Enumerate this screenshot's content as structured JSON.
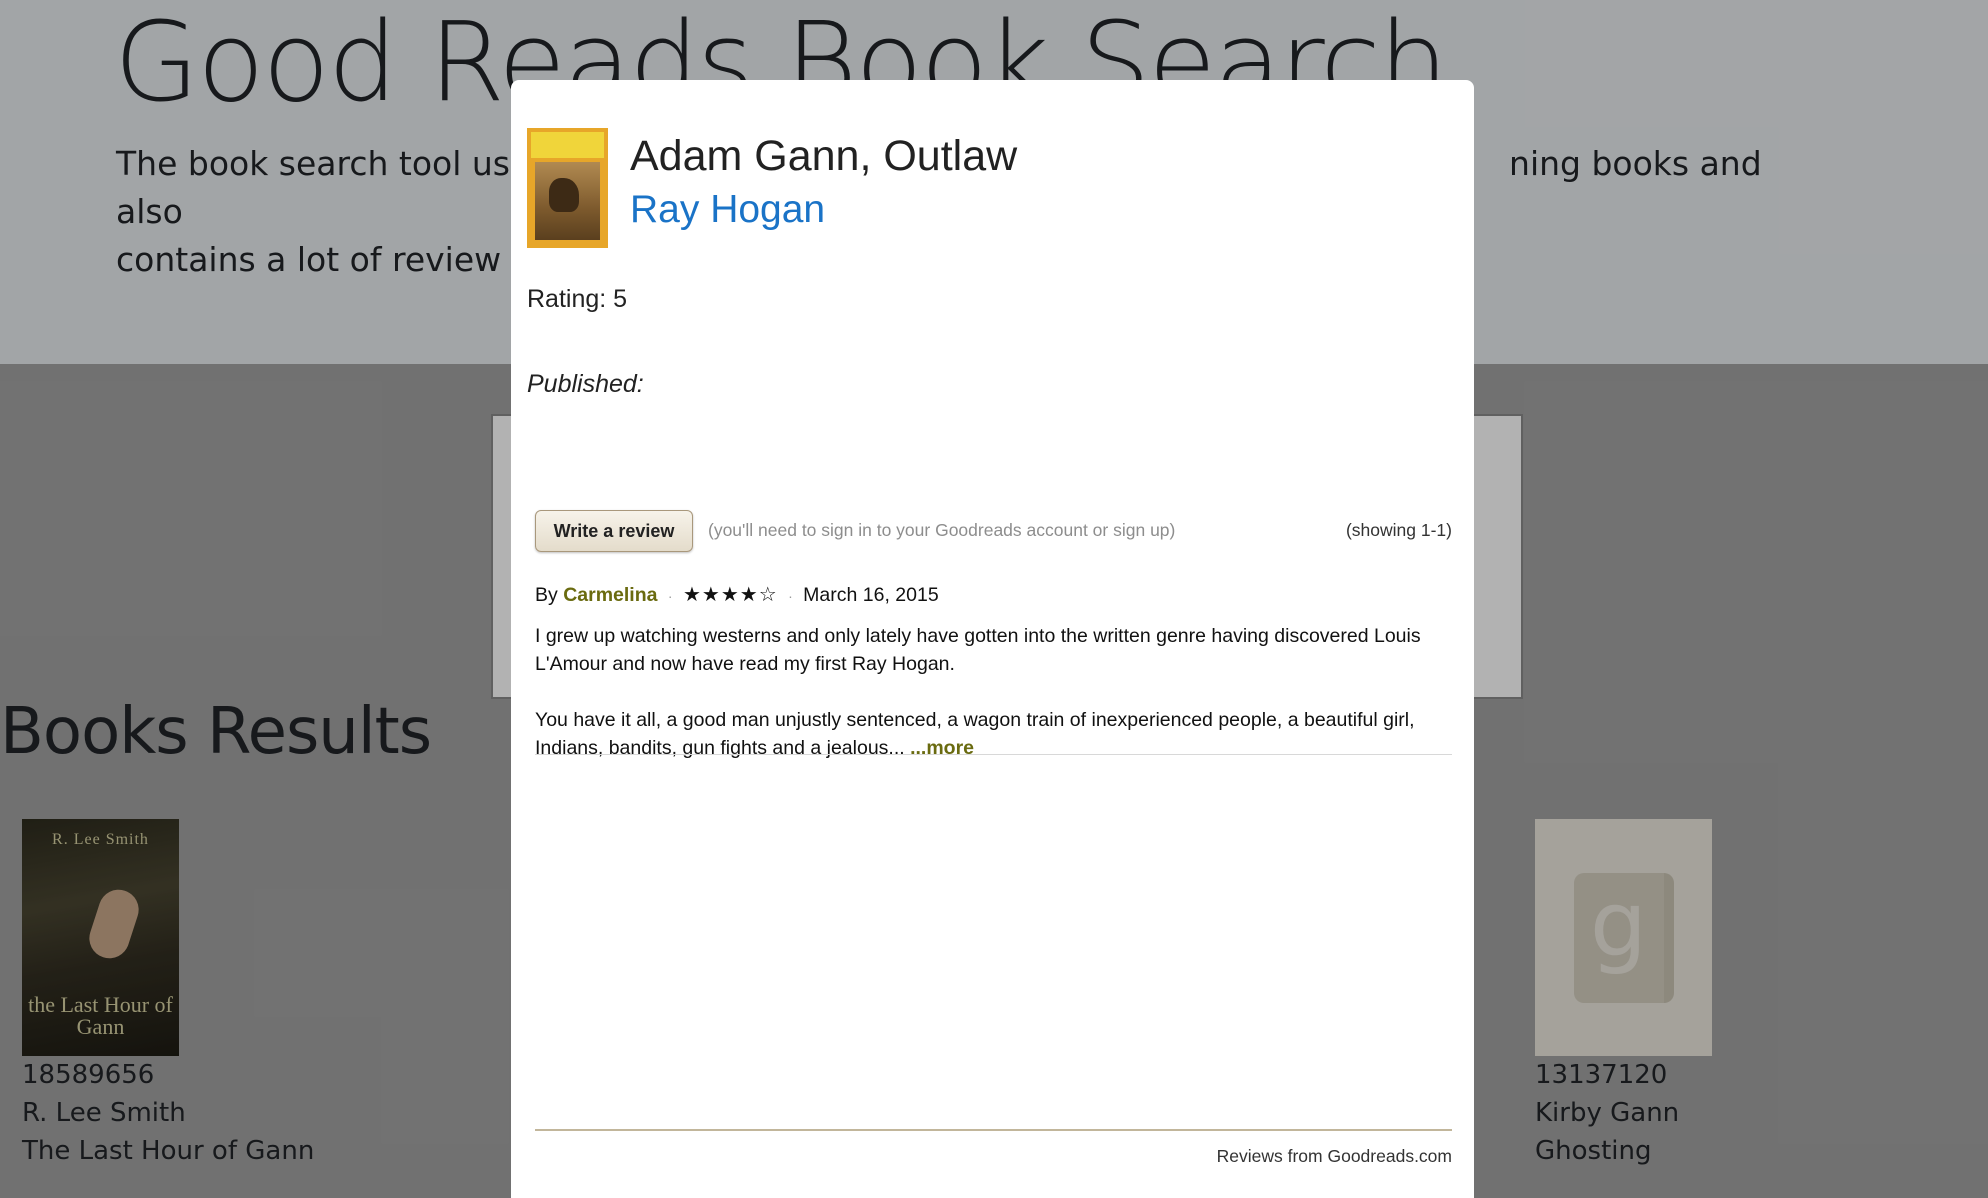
{
  "hero": {
    "title": "Good Reads Book Search",
    "description_line1_left": "The book search tool using",
    "description_line1_right": "ning books and also",
    "description_line2": "contains a lot of review dat"
  },
  "results": {
    "title": "Books Results",
    "books": [
      {
        "id": "18589656",
        "author": "R. Lee Smith",
        "title": "The Last Hour of Gann",
        "cover_text_author": "R. Lee Smith",
        "cover_text_title": "the Last Hour of Gann"
      },
      {
        "id": "13137120",
        "author": "Kirby Gann",
        "title": "Ghosting",
        "cover_icon": "goodreads-g-book-icon"
      }
    ]
  },
  "modal": {
    "book_title": "Adam Gann, Outlaw",
    "author": "Ray Hogan",
    "rating_text": "Rating: 5",
    "published_text": "Published:",
    "widget": {
      "write_review_label": "Write a review",
      "signin_note": "(you'll need to sign in to your Goodreads account or sign up)",
      "showing_text": "(showing 1-1)",
      "review": {
        "by_label": "By",
        "reviewer": "Carmelina",
        "stars": "★★★★☆",
        "star_rating": 4,
        "date": "March 16, 2015",
        "paragraph1": "I grew up watching westerns and only lately have gotten into the written genre having discovered Louis L'Amour and now have read my first Ray Hogan.",
        "paragraph2": "You have it all, a good man unjustly sentenced, a wagon train of inexperienced people, a beautiful girl, Indians, bandits, gun fights and a jealous... ",
        "more_link": "...more"
      },
      "credit": "Reviews from Goodreads.com"
    }
  },
  "colors": {
    "author_link": "#1a73c7",
    "goodreads_link": "#6a6b10",
    "overlay": "rgba(0,0,0,0.3)"
  }
}
